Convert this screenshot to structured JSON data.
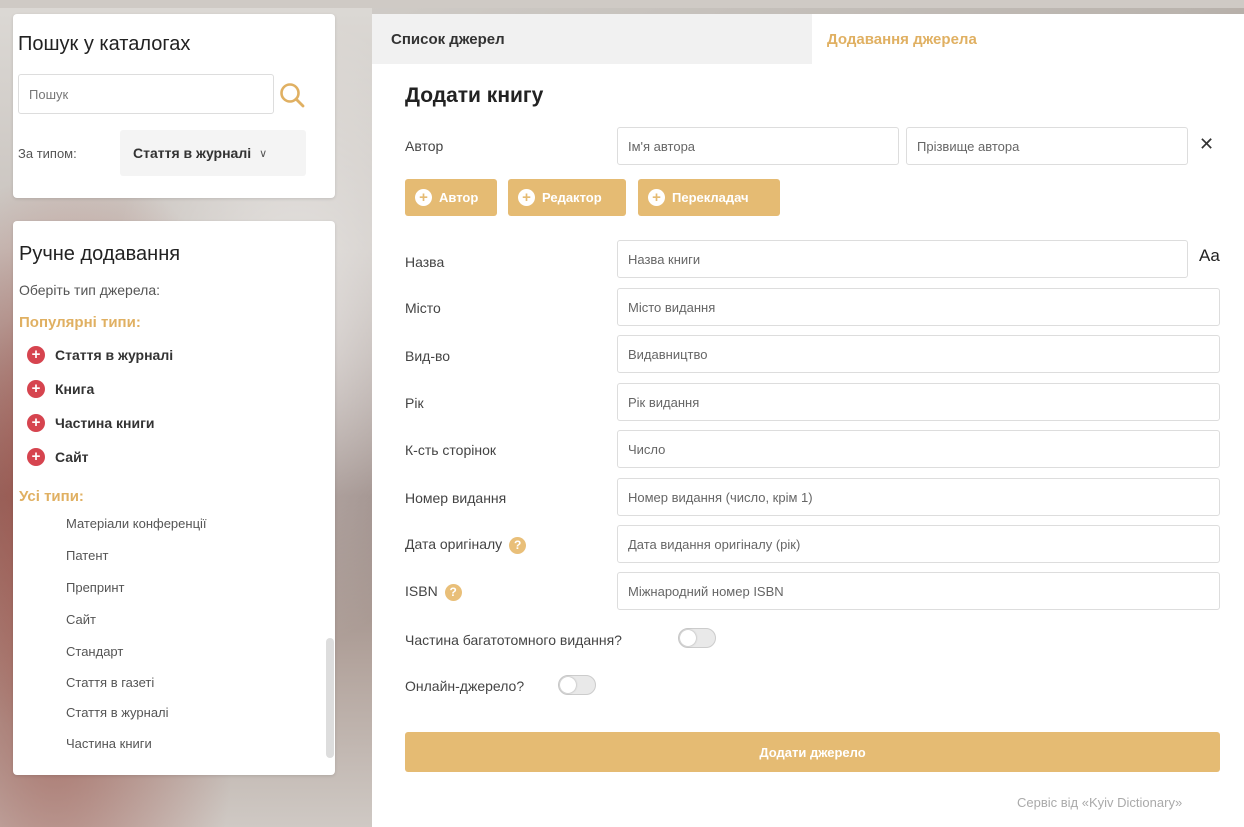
{
  "search": {
    "title": "Пошук у каталогах",
    "placeholder": "Пошук",
    "type_label": "За типом:",
    "type_value": "Стаття в журналі"
  },
  "manual": {
    "title": "Ручне додавання",
    "subtitle": "Оберіть тип джерела:",
    "popular_head": "Популярні типи:",
    "popular": [
      "Стаття в журналі",
      "Книга",
      "Частина книги",
      "Сайт"
    ],
    "all_head": "Усі типи:",
    "all": [
      "Матеріали конференції",
      "Патент",
      "Препринт",
      "Сайт",
      "Стандарт",
      "Стаття в газеті",
      "Стаття в журналі",
      "Частина книги"
    ]
  },
  "tabs": {
    "list": "Список джерел",
    "add": "Додавання джерела"
  },
  "form": {
    "title": "Додати книгу",
    "author_label": "Автор",
    "author_first_ph": "Ім'я автора",
    "author_last_ph": "Прізвище автора",
    "buttons": {
      "author": "Автор",
      "editor": "Редактор",
      "translator": "Перекладач"
    },
    "title_label": "Назва",
    "title_ph": "Назва книги",
    "aa": "Aa",
    "city_label": "Місто",
    "city_ph": "Місто видання",
    "publisher_label": "Вид-во",
    "publisher_ph": "Видавництво",
    "year_label": "Рік",
    "year_ph": "Рік видання",
    "pages_label": "К-сть сторінок",
    "pages_ph": "Число",
    "edition_label": "Номер видання",
    "edition_ph": "Номер видання (число, крім 1)",
    "orig_label": "Дата оригіналу",
    "orig_ph": "Дата видання оригіналу (рік)",
    "isbn_label": "ISBN",
    "isbn_ph": "Міжнародний номер ISBN",
    "multivolume": "Частина багатотомного видання?",
    "online": "Онлайн-джерело?",
    "submit": "Додати джерело"
  },
  "footer": "Сервіс від «Kyiv Dictionary»",
  "colors": {
    "accent": "#e5bb73",
    "red": "#d6444f"
  },
  "icons": {
    "search": "search-icon",
    "close": "close-icon",
    "plus": "plus-icon",
    "help": "help-icon",
    "chevron": "chevron-down-icon"
  }
}
